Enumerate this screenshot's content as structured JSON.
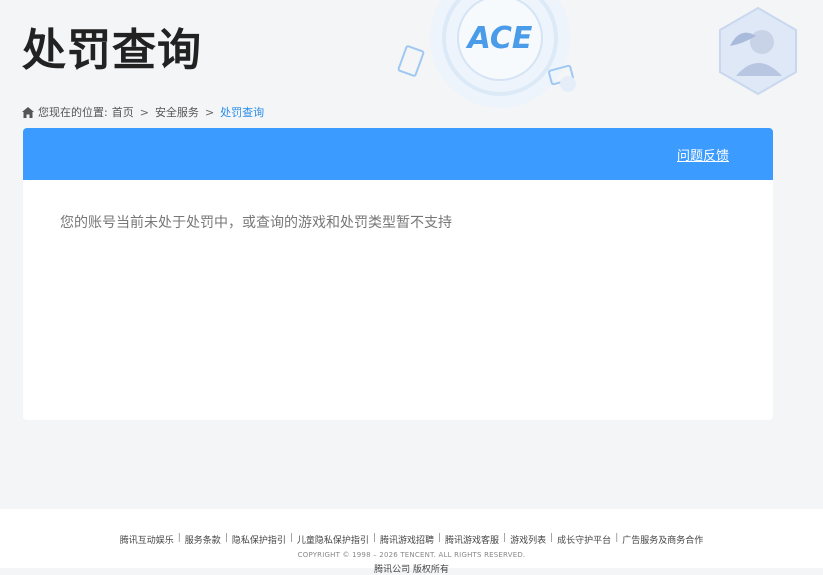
{
  "header": {
    "title": "处罚查询",
    "logo_text": "ACE"
  },
  "breadcrumb": {
    "prefix": "您现在的位置:",
    "items": [
      "首页",
      "安全服务"
    ],
    "separator": ">",
    "current": "处罚查询"
  },
  "card": {
    "feedback_label": "问题反馈",
    "message": "您的账号当前未处于处罚中，或查询的游戏和处罚类型暂不支持"
  },
  "footer": {
    "links": [
      "腾讯互动娱乐",
      "服务条款",
      "隐私保护指引",
      "儿童隐私保护指引",
      "腾讯游戏招聘",
      "腾讯游戏客服",
      "游戏列表",
      "成长守护平台",
      "广告服务及商务合作"
    ],
    "copyright": "COPYRIGHT © 1998 – 2026 TENCENT. ALL RIGHTS RESERVED.",
    "company": "腾讯公司 版权所有"
  },
  "colors": {
    "accent": "#3b9bff",
    "current_crumb": "#2a8de8",
    "background": "#f4f5f7"
  }
}
